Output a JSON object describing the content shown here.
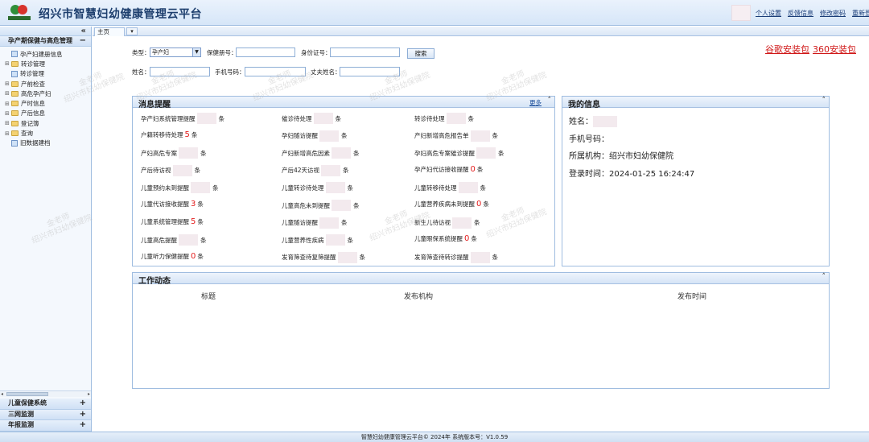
{
  "header": {
    "title": "绍兴市智慧妇幼健康管理云平台",
    "links": [
      "个人设置",
      "反馈信息",
      "修改密码",
      "重新登录"
    ]
  },
  "sidebar": {
    "collapse": "«",
    "main_panel": {
      "title": "孕产期保健与高危管理",
      "toggle": "−"
    },
    "items": [
      {
        "label": "孕产妇建册信息",
        "type": "page",
        "expand": ""
      },
      {
        "label": "转诊管理",
        "type": "folder",
        "expand": "⊞"
      },
      {
        "label": "转诊管理",
        "type": "page",
        "expand": ""
      },
      {
        "label": "产前检查",
        "type": "folder",
        "expand": "⊞"
      },
      {
        "label": "高危孕产妇",
        "type": "folder",
        "expand": "⊞"
      },
      {
        "label": "产时信息",
        "type": "folder",
        "expand": "⊞"
      },
      {
        "label": "产后信息",
        "type": "folder",
        "expand": "⊞"
      },
      {
        "label": "登记簿",
        "type": "folder",
        "expand": "⊞"
      },
      {
        "label": "查询",
        "type": "folder",
        "expand": "⊞"
      },
      {
        "label": "旧数据建档",
        "type": "page",
        "expand": ""
      }
    ],
    "bottom_panels": [
      {
        "title": "儿童保健系统",
        "toggle": "+"
      },
      {
        "title": "三网监测",
        "toggle": "+"
      },
      {
        "title": "年报监测",
        "toggle": "+"
      }
    ]
  },
  "tabs": {
    "home": "主页",
    "dropdown": "▾"
  },
  "filters": {
    "type_label": "类型：",
    "type_value": "孕产妇",
    "book_no_label": "保健册号：",
    "id_label": "身份证号：",
    "search_button": "搜索",
    "name_label": "姓名：",
    "phone_label": "手机号码：",
    "husband_label": "丈夫姓名："
  },
  "install_links": [
    "谷歌安装包",
    "360安装包"
  ],
  "messages": {
    "title": "消息提醒",
    "more": "更多",
    "caret": "˄",
    "items": [
      {
        "label": "孕产妇系统管理提醒",
        "count": "",
        "unit": "条"
      },
      {
        "label": "催诊待处理",
        "count": "",
        "unit": "条"
      },
      {
        "label": "转诊待处理",
        "count": "",
        "unit": "条"
      },
      {
        "label": "户籍转移待处理",
        "count": "5",
        "unit": "条"
      },
      {
        "label": "孕妇随访提醒",
        "count": "",
        "unit": "条"
      },
      {
        "label": "产妇新增高危报告单",
        "count": "",
        "unit": "条"
      },
      {
        "label": "产妇高危专案",
        "count": "",
        "unit": "条"
      },
      {
        "label": "产妇新增高危因素",
        "count": "",
        "unit": "条"
      },
      {
        "label": "孕妇高危专案催诊提醒",
        "count": "",
        "unit": "条"
      },
      {
        "label": "产后待访视",
        "count": "",
        "unit": "条"
      },
      {
        "label": "产后42天访视",
        "count": "",
        "unit": "条"
      },
      {
        "label": "孕产妇代访接收提醒",
        "count": "0",
        "unit": "条"
      },
      {
        "label": "儿童预约未到提醒",
        "count": "",
        "unit": "条"
      },
      {
        "label": "儿童转诊待处理",
        "count": "",
        "unit": "条"
      },
      {
        "label": "儿童转移待处理",
        "count": "",
        "unit": "条"
      },
      {
        "label": "儿童代访接收提醒",
        "count": "3",
        "unit": "条"
      },
      {
        "label": "儿童高危未到提醒",
        "count": "",
        "unit": "条"
      },
      {
        "label": "儿童营养疾病未到提醒",
        "count": "0",
        "unit": "条"
      },
      {
        "label": "儿童系统管理提醒",
        "count": "5",
        "unit": "条"
      },
      {
        "label": "儿童随访提醒",
        "count": "",
        "unit": "条"
      },
      {
        "label": "新生儿待访视",
        "count": "",
        "unit": "条"
      },
      {
        "label": "儿童高危提醒",
        "count": "",
        "unit": "条"
      },
      {
        "label": "儿童营养性疾病",
        "count": "",
        "unit": "条"
      },
      {
        "label": "儿童眼保系统提醒",
        "count": "0",
        "unit": "条"
      },
      {
        "label": "儿童听力保健提醒",
        "count": "0",
        "unit": "条"
      },
      {
        "label": "发育筛查待复筛提醒",
        "count": "",
        "unit": "条"
      },
      {
        "label": "发育筛查待转诊提醒",
        "count": "",
        "unit": "条"
      }
    ]
  },
  "my_info": {
    "title": "我的信息",
    "caret": "˄",
    "name_label": "姓名：",
    "phone_label": "手机号码：",
    "org_label": "所属机构：",
    "org_value": "绍兴市妇幼保健院",
    "login_label": "登录时间：",
    "login_value": "2024-01-25 16:24:47"
  },
  "work": {
    "title": "工作动态",
    "caret": "˄",
    "columns": [
      "标题",
      "发布机构",
      "发布时间"
    ]
  },
  "watermark": {
    "line1": "金老师",
    "line2": "绍兴市妇幼保健院"
  },
  "footer": "智慧妇幼健康管理云平台© 2024年 系统版本号：V1.0.59"
}
